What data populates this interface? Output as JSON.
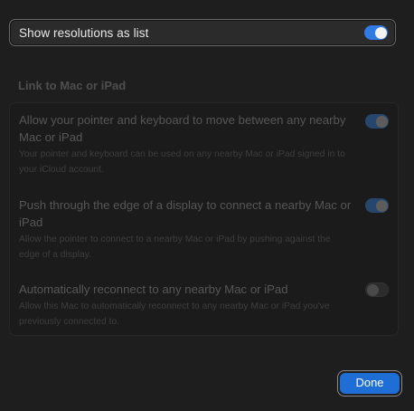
{
  "top_toggle": {
    "label": "Show resolutions as list",
    "state": "on"
  },
  "section": {
    "title": "Link to Mac or iPad"
  },
  "items": [
    {
      "title": "Allow your pointer and keyboard to move between any nearby Mac or iPad",
      "description": "Your pointer and keyboard can be used on any nearby Mac or iPad signed in to your iCloud account.",
      "state": "on"
    },
    {
      "title": "Push through the edge of a display to connect a nearby Mac or iPad",
      "description": "Allow the pointer to connect to a nearby Mac or iPad by pushing against the edge of a display.",
      "state": "on"
    },
    {
      "title": "Automatically reconnect to any nearby Mac or iPad",
      "description": "Allow this Mac to automatically reconnect to any nearby Mac or iPad you've previously connected to.",
      "state": "off"
    }
  ],
  "buttons": {
    "done_label": "Done"
  },
  "colors": {
    "accent": "#2f7ae5",
    "button": "#1f6ed6"
  }
}
